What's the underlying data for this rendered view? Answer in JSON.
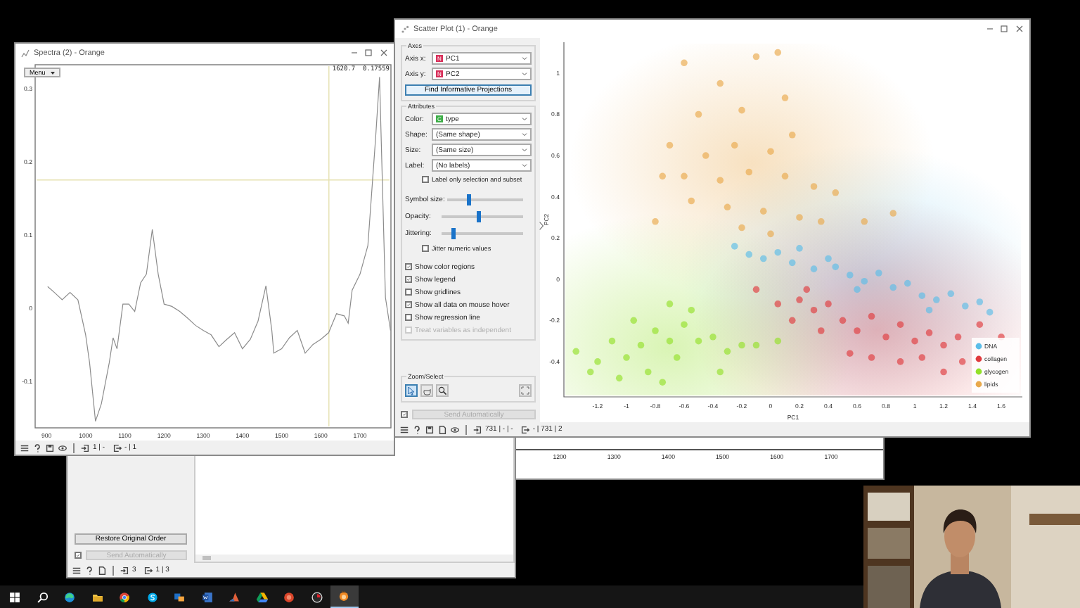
{
  "spectra_window": {
    "title": "Spectra (2) - Orange",
    "menu_button": "Menu",
    "readout": "1620.7  0.17559",
    "chart_data": {
      "type": "line",
      "xlim": [
        871,
        1779
      ],
      "ylim": [
        -0.163,
        0.333
      ],
      "xticks": [
        900,
        1000,
        1100,
        1200,
        1300,
        1400,
        1500,
        1600,
        1700
      ],
      "yticks": [
        -0.1,
        0,
        0.1,
        0.2,
        0.3
      ],
      "x": [
        903,
        920,
        940,
        960,
        980,
        1000,
        1010,
        1025,
        1040,
        1060,
        1070,
        1080,
        1095,
        1110,
        1125,
        1140,
        1155,
        1170,
        1185,
        1200,
        1220,
        1240,
        1260,
        1280,
        1300,
        1320,
        1340,
        1360,
        1380,
        1400,
        1420,
        1440,
        1460,
        1475,
        1480,
        1500,
        1520,
        1540,
        1560,
        1580,
        1600,
        1620,
        1640,
        1660,
        1670,
        1680,
        1700,
        1720,
        1740,
        1750,
        1765,
        1778
      ],
      "series": [
        {
          "color": "#8c8c8c",
          "values": [
            0.03,
            0.022,
            0.012,
            0.022,
            0.012,
            -0.036,
            -0.074,
            -0.154,
            -0.13,
            -0.074,
            -0.04,
            -0.055,
            0.006,
            0.006,
            -0.004,
            0.035,
            0.047,
            0.108,
            0.047,
            0.006,
            0.003,
            -0.004,
            -0.013,
            -0.023,
            -0.03,
            -0.036,
            -0.052,
            -0.042,
            -0.033,
            -0.055,
            -0.042,
            -0.017,
            0.031,
            -0.03,
            -0.061,
            -0.055,
            -0.04,
            -0.03,
            -0.061,
            -0.049,
            -0.042,
            -0.033,
            -0.007,
            -0.01,
            -0.02,
            0.025,
            0.047,
            0.086,
            0.233,
            0.316,
            0.015,
            -0.03
          ]
        }
      ],
      "ref_lines": [
        {
          "axis": "x",
          "value": 1620.7
        },
        {
          "axis": "y",
          "value": 0.17559
        }
      ]
    },
    "status_bar": {
      "inputs": "1 | -",
      "outputs": "- | 1"
    }
  },
  "scatter_window": {
    "title": "Scatter Plot (1) - Orange",
    "axes_group": {
      "title": "Axes",
      "fields": [
        {
          "label": "Axis x:",
          "badge": "N",
          "color": "#d8315b",
          "value": "PC1"
        },
        {
          "label": "Axis y:",
          "badge": "N",
          "color": "#d8315b",
          "value": "PC2"
        }
      ],
      "button": "Find Informative Projections"
    },
    "attributes_group": {
      "title": "Attributes",
      "fields": [
        {
          "label": "Color:",
          "badge": "C",
          "color": "#3fae49",
          "value": "type"
        },
        {
          "label": "Shape:",
          "value": "(Same shape)"
        },
        {
          "label": "Size:",
          "value": "(Same size)"
        },
        {
          "label": "Label:",
          "value": "(No labels)"
        }
      ],
      "checkbox": {
        "label": "Label only selection and subset",
        "checked": false
      }
    },
    "sliders": [
      {
        "label": "Symbol size:",
        "level": 0.28
      },
      {
        "label": "Opacity:",
        "level": 0.45
      },
      {
        "label": "Jittering:",
        "level": 0.15
      }
    ],
    "jitter_checkbox": {
      "label": "Jitter numeric values",
      "checked": false
    },
    "options": [
      {
        "label": "Show color regions",
        "checked": true,
        "disabled": false
      },
      {
        "label": "Show legend",
        "checked": true,
        "disabled": false
      },
      {
        "label": "Show gridlines",
        "checked": false,
        "disabled": false
      },
      {
        "label": "Show all data on mouse hover",
        "checked": true,
        "disabled": false
      },
      {
        "label": "Show regression line",
        "checked": false,
        "disabled": false
      },
      {
        "label": "Treat variables as independent",
        "checked": false,
        "disabled": true
      }
    ],
    "zoom_group": {
      "title": "Zoom/Select",
      "tools": [
        {
          "kind": "select",
          "selected": true
        },
        {
          "kind": "pan",
          "selected": false
        },
        {
          "kind": "zoom",
          "selected": false
        }
      ]
    },
    "send": {
      "label": "Send Automatically",
      "checked": true,
      "disabled": true
    },
    "chart_data": {
      "type": "scatter",
      "legend": true,
      "xlabel": "PC1",
      "ylabel": "PC2",
      "xlim": [
        -1.434,
        1.746
      ],
      "ylim": [
        -0.571,
        1.15
      ],
      "xticks": [
        -1.2,
        -1,
        -0.8,
        -0.6,
        -0.4,
        -0.2,
        0,
        0.2,
        0.4,
        0.6,
        0.8,
        1,
        1.2,
        1.4,
        1.6
      ],
      "yticks": [
        -0.4,
        -0.2,
        0,
        0.2,
        0.4,
        0.6,
        0.8,
        1
      ],
      "series": [
        {
          "name": "DNA",
          "color": "#5bbde8",
          "x": [
            -0.25,
            -0.15,
            -0.05,
            0.05,
            0.15,
            0.3,
            0.45,
            0.55,
            0.65,
            0.75,
            0.85,
            0.95,
            1.05,
            1.15,
            1.25,
            1.35,
            1.45,
            1.52,
            0.4,
            0.2,
            0.6,
            1.1
          ],
          "values": [
            0.16,
            0.12,
            0.1,
            0.13,
            0.08,
            0.05,
            0.06,
            0.02,
            -0.01,
            0.03,
            -0.04,
            -0.02,
            -0.08,
            -0.1,
            -0.07,
            -0.13,
            -0.11,
            -0.16,
            0.1,
            0.15,
            -0.05,
            -0.15
          ]
        },
        {
          "name": "collagen",
          "color": "#e03a3e",
          "x": [
            -0.1,
            0.05,
            0.2,
            0.3,
            0.15,
            0.4,
            0.5,
            0.35,
            0.6,
            0.7,
            0.8,
            0.9,
            1.0,
            1.1,
            1.2,
            1.3,
            1.33,
            1.45,
            1.6,
            0.7,
            0.9,
            1.2,
            0.55,
            0.25,
            1.05
          ],
          "values": [
            -0.05,
            -0.12,
            -0.1,
            -0.15,
            -0.2,
            -0.12,
            -0.2,
            -0.25,
            -0.25,
            -0.18,
            -0.28,
            -0.22,
            -0.3,
            -0.26,
            -0.32,
            -0.28,
            -0.4,
            -0.22,
            -0.28,
            -0.38,
            -0.4,
            -0.45,
            -0.36,
            -0.05,
            -0.38
          ]
        },
        {
          "name": "glycogen",
          "color": "#93e02a",
          "x": [
            -1.35,
            -1.2,
            -1.1,
            -1.0,
            -0.9,
            -0.8,
            -0.7,
            -0.6,
            -0.65,
            -0.85,
            -1.05,
            -1.25,
            -0.5,
            -0.4,
            -0.3,
            -0.2,
            -0.55,
            -0.7,
            -0.95,
            -0.75,
            -0.35,
            -0.1,
            0.05
          ],
          "values": [
            -0.35,
            -0.4,
            -0.3,
            -0.38,
            -0.32,
            -0.25,
            -0.3,
            -0.22,
            -0.38,
            -0.45,
            -0.48,
            -0.45,
            -0.3,
            -0.28,
            -0.35,
            -0.32,
            -0.15,
            -0.12,
            -0.2,
            -0.5,
            -0.45,
            -0.32,
            -0.3
          ]
        },
        {
          "name": "lipids",
          "color": "#e9a94c",
          "x": [
            -0.6,
            -0.35,
            -0.1,
            0.05,
            -0.5,
            -0.2,
            0.1,
            -0.7,
            -0.45,
            -0.25,
            0,
            0.15,
            -0.6,
            -0.35,
            -0.15,
            0.1,
            0.3,
            -0.55,
            -0.3,
            -0.05,
            0.2,
            -0.8,
            0,
            0.35,
            0.65,
            0.85,
            -0.2,
            0.45,
            -0.75
          ],
          "values": [
            1.05,
            0.95,
            1.08,
            1.1,
            0.8,
            0.82,
            0.88,
            0.65,
            0.6,
            0.65,
            0.62,
            0.7,
            0.5,
            0.48,
            0.52,
            0.5,
            0.45,
            0.38,
            0.35,
            0.33,
            0.3,
            0.28,
            0.22,
            0.28,
            0.28,
            0.32,
            0.25,
            0.42,
            0.5
          ]
        }
      ]
    },
    "status_bar": {
      "inputs": "731 | - | -",
      "outputs": "- | 731 | 2"
    }
  },
  "back_window": {
    "restore_button": "Restore Original Order",
    "send": {
      "label": "Send Automatically",
      "checked": true,
      "disabled": true
    },
    "status_bar": {
      "inputs": "3",
      "outputs": "1 | 3"
    }
  },
  "plot_strip": {
    "tick_labels": [
      "1200",
      "1300",
      "1400",
      "1500",
      "1600",
      "1700"
    ]
  },
  "taskbar": {
    "apps": [
      {
        "kind": "start",
        "active": false
      },
      {
        "kind": "search",
        "active": false
      },
      {
        "kind": "edge",
        "active": false
      },
      {
        "kind": "explorer",
        "active": false
      },
      {
        "kind": "chrome",
        "active": false
      },
      {
        "kind": "skype",
        "active": false
      },
      {
        "kind": "teams",
        "active": false
      },
      {
        "kind": "word",
        "active": false
      },
      {
        "kind": "matlab",
        "active": false
      },
      {
        "kind": "drive",
        "active": false
      },
      {
        "kind": "office",
        "active": false
      },
      {
        "kind": "recorder",
        "active": false
      },
      {
        "kind": "orange",
        "active": true
      }
    ]
  }
}
